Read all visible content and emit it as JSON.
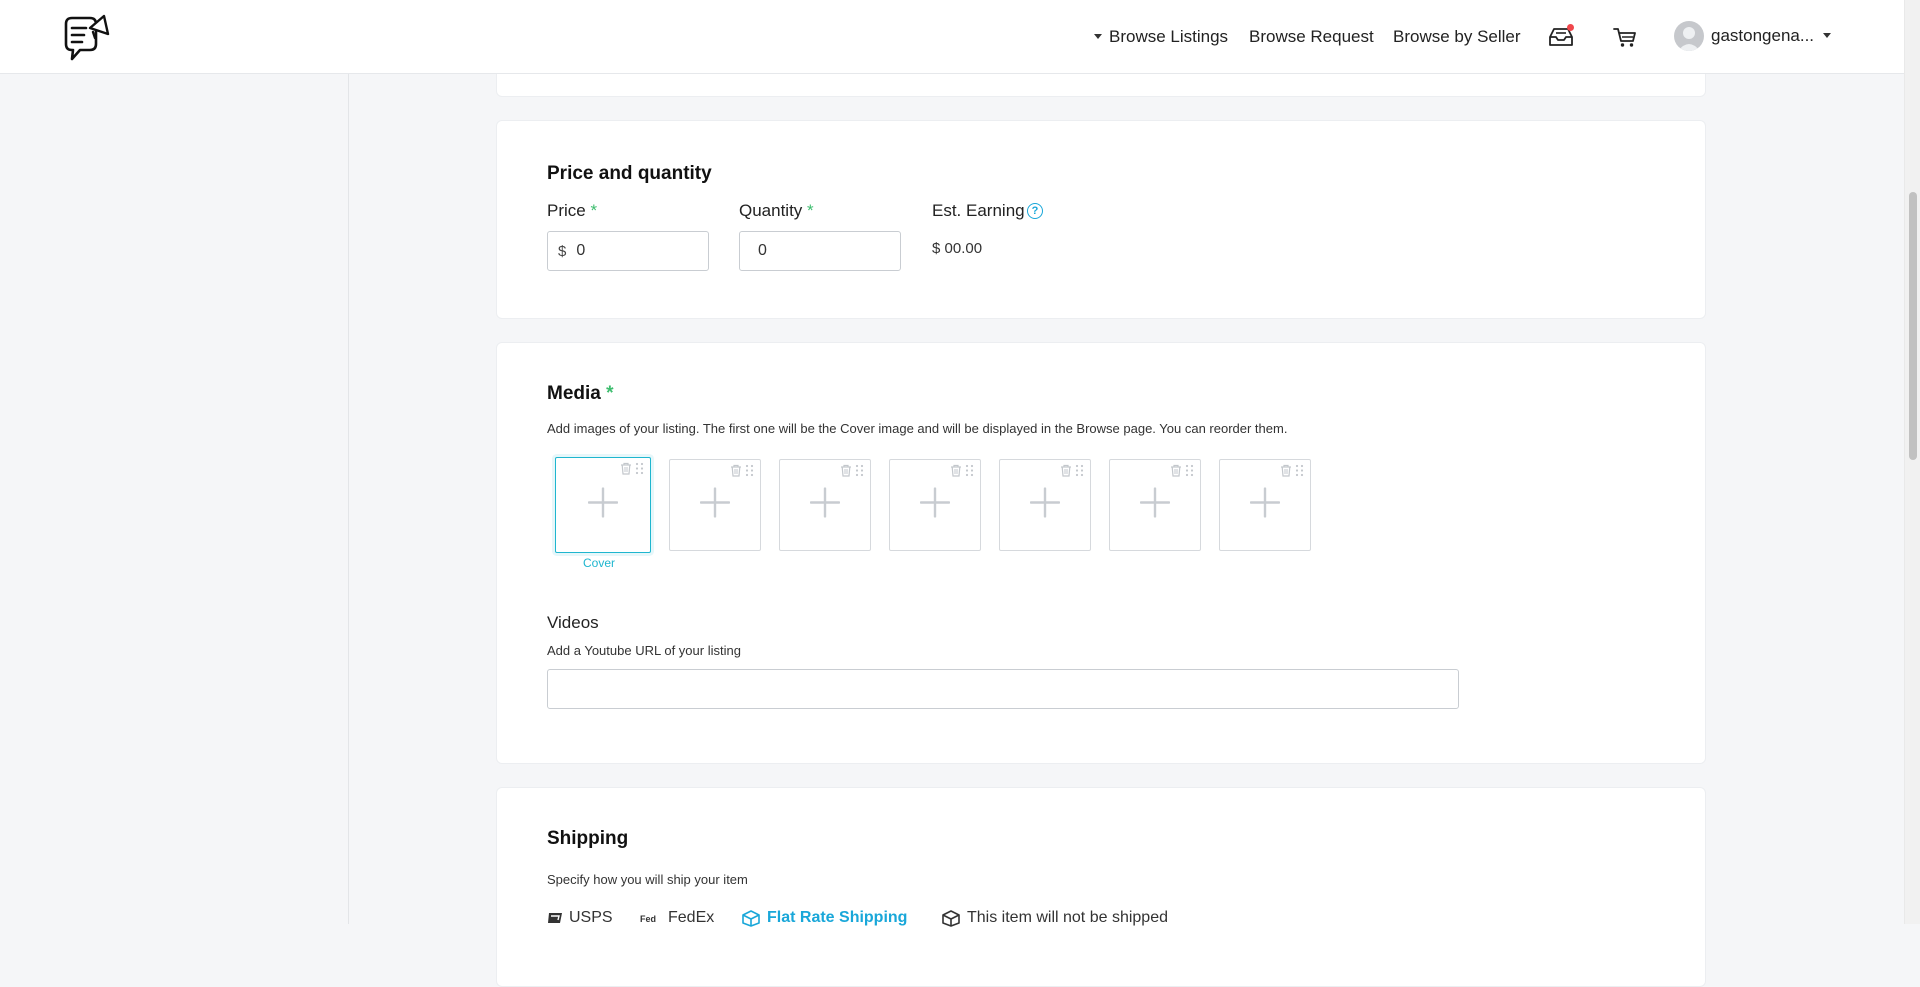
{
  "header": {
    "logo": "speech-bubble-megaphone-logo",
    "nav": {
      "browse_listings": "Browse Listings",
      "browse_request": "Browse Request",
      "browse_by_seller": "Browse by Seller"
    },
    "icons": [
      "inbox-icon",
      "cart-icon"
    ],
    "user": {
      "name": "gastongena..."
    },
    "colors": {
      "notification_dot": "#f0474c"
    }
  },
  "price_section": {
    "title": "Price and quantity",
    "price_label": "Price",
    "price_required": "*",
    "price_prefix": "$",
    "price_value": "0",
    "quantity_label": "Quantity",
    "quantity_required": "*",
    "quantity_value": "0",
    "earning_label": "Est. Earning",
    "earning_help": "?",
    "earning_value": "$ 00.00"
  },
  "media_section": {
    "title": "Media",
    "required": "*",
    "description": "Add images of your listing. The first one will be the Cover image and will be displayed in the Browse page. You can reorder them.",
    "slots": [
      {
        "is_cover": true
      },
      {
        "is_cover": false
      },
      {
        "is_cover": false
      },
      {
        "is_cover": false
      },
      {
        "is_cover": false
      },
      {
        "is_cover": false
      },
      {
        "is_cover": false
      }
    ],
    "cover_label": "Cover",
    "videos_title": "Videos",
    "videos_description": "Add a Youtube URL of your listing",
    "video_url_value": ""
  },
  "shipping_section": {
    "title": "Shipping",
    "description": "Specify how you will ship your item",
    "options": [
      {
        "label": "USPS",
        "icon": "usps-logo-icon",
        "active": false
      },
      {
        "label": "FedEx",
        "icon": "fedex-logo-icon",
        "active": false
      },
      {
        "label": "Flat Rate Shipping",
        "icon": "box-icon",
        "active": true
      },
      {
        "label": "This item will not be shipped",
        "icon": "package-icon",
        "active": false
      }
    ]
  },
  "colors": {
    "accent": "#19a7d9",
    "required": "#3dbd6e",
    "cover_border": "#1fb6cf"
  }
}
